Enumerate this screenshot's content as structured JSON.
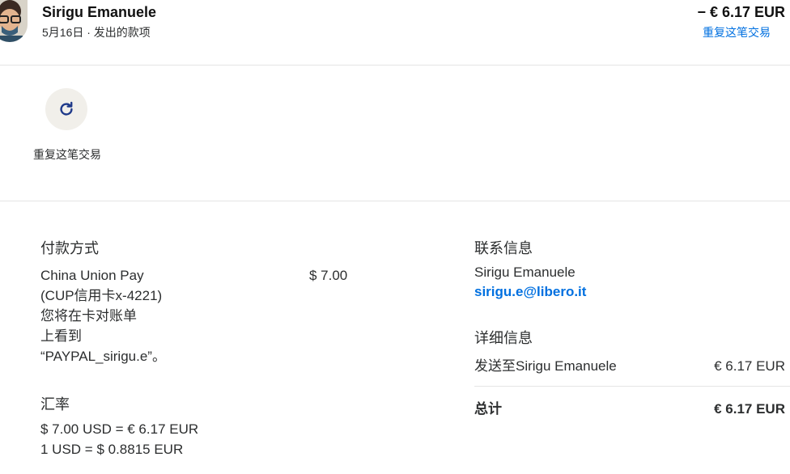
{
  "header": {
    "name": "Sirigu Emanuele",
    "date_type": "5月16日 · 发出的款项",
    "amount": "− € 6.17 EUR",
    "repeat_link": "重复这笔交易"
  },
  "actions": {
    "repeat_label": "重复这笔交易",
    "repeat_icon": "refresh-icon"
  },
  "payment": {
    "heading": "付款方式",
    "method_lines": [
      "China Union Pay",
      "(CUP信用卡x-4221)",
      "您将在卡对账单",
      "上看到",
      "“PAYPAL_sirigu.e”。"
    ],
    "amount": "$ 7.00"
  },
  "exchange": {
    "heading": "汇率",
    "line1": "$ 7.00 USD = € 6.17 EUR",
    "line2": "1 USD = $ 0.8815 EUR"
  },
  "contact": {
    "heading": "联系信息",
    "name": "Sirigu Emanuele",
    "email": "sirigu.e@libero.it"
  },
  "details": {
    "heading": "详细信息",
    "sent_to_label": "发送至Sirigu Emanuele",
    "sent_to_amount": "€ 6.17 EUR",
    "total_label": "总计",
    "total_amount": "€ 6.17 EUR"
  },
  "colors": {
    "link": "#0070e0",
    "text": "#2c2e2f",
    "divider": "#e5e5e5",
    "icon_bg": "#f1efea"
  }
}
